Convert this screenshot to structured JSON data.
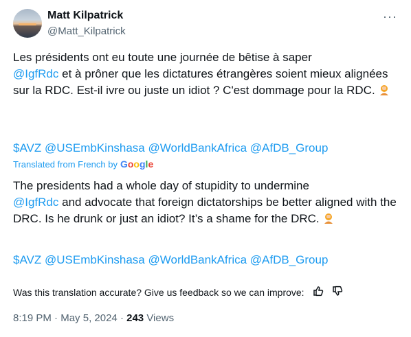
{
  "author": {
    "name": "Matt Kilpatrick",
    "handle": "@Matt_Kilpatrick"
  },
  "more_icon": "···",
  "original": {
    "p1": "Les présidents ont eu toute une journée de bêtise à saper",
    "mention": "@IgfRdc",
    "p2": " et à prôner que les dictatures étrangères soient mieux alignées sur la RDC. Est-il ivre ou juste un idiot ? C'est dommage pour la RDC. ",
    "tags": [
      "$AVZ",
      "@USEmbKinshasa",
      "@WorldBankAfrica",
      "@AfDB_Group"
    ]
  },
  "translated_from": "Translated from French by",
  "google": [
    "G",
    "o",
    "o",
    "g",
    "l",
    "e"
  ],
  "translation": {
    "p1": "The presidents had a whole day of stupidity to undermine",
    "mention": "@IgfRdc",
    "p2": " and advocate that foreign dictatorships be better aligned with the DRC. Is he drunk or just an idiot? It’s a shame for the DRC. ",
    "tags": [
      "$AVZ",
      "@USEmbKinshasa",
      "@WorldBankAfrica",
      "@AfDB_Group"
    ]
  },
  "feedback_text": "Was this translation accurate? Give us feedback so we can improve:",
  "meta": {
    "time": "8:19 PM",
    "sep": " · ",
    "date": "May 5, 2024",
    "views": "243",
    "views_label": "Views"
  },
  "colors": {
    "link": "#1d9bf0",
    "secondary": "#536471"
  }
}
